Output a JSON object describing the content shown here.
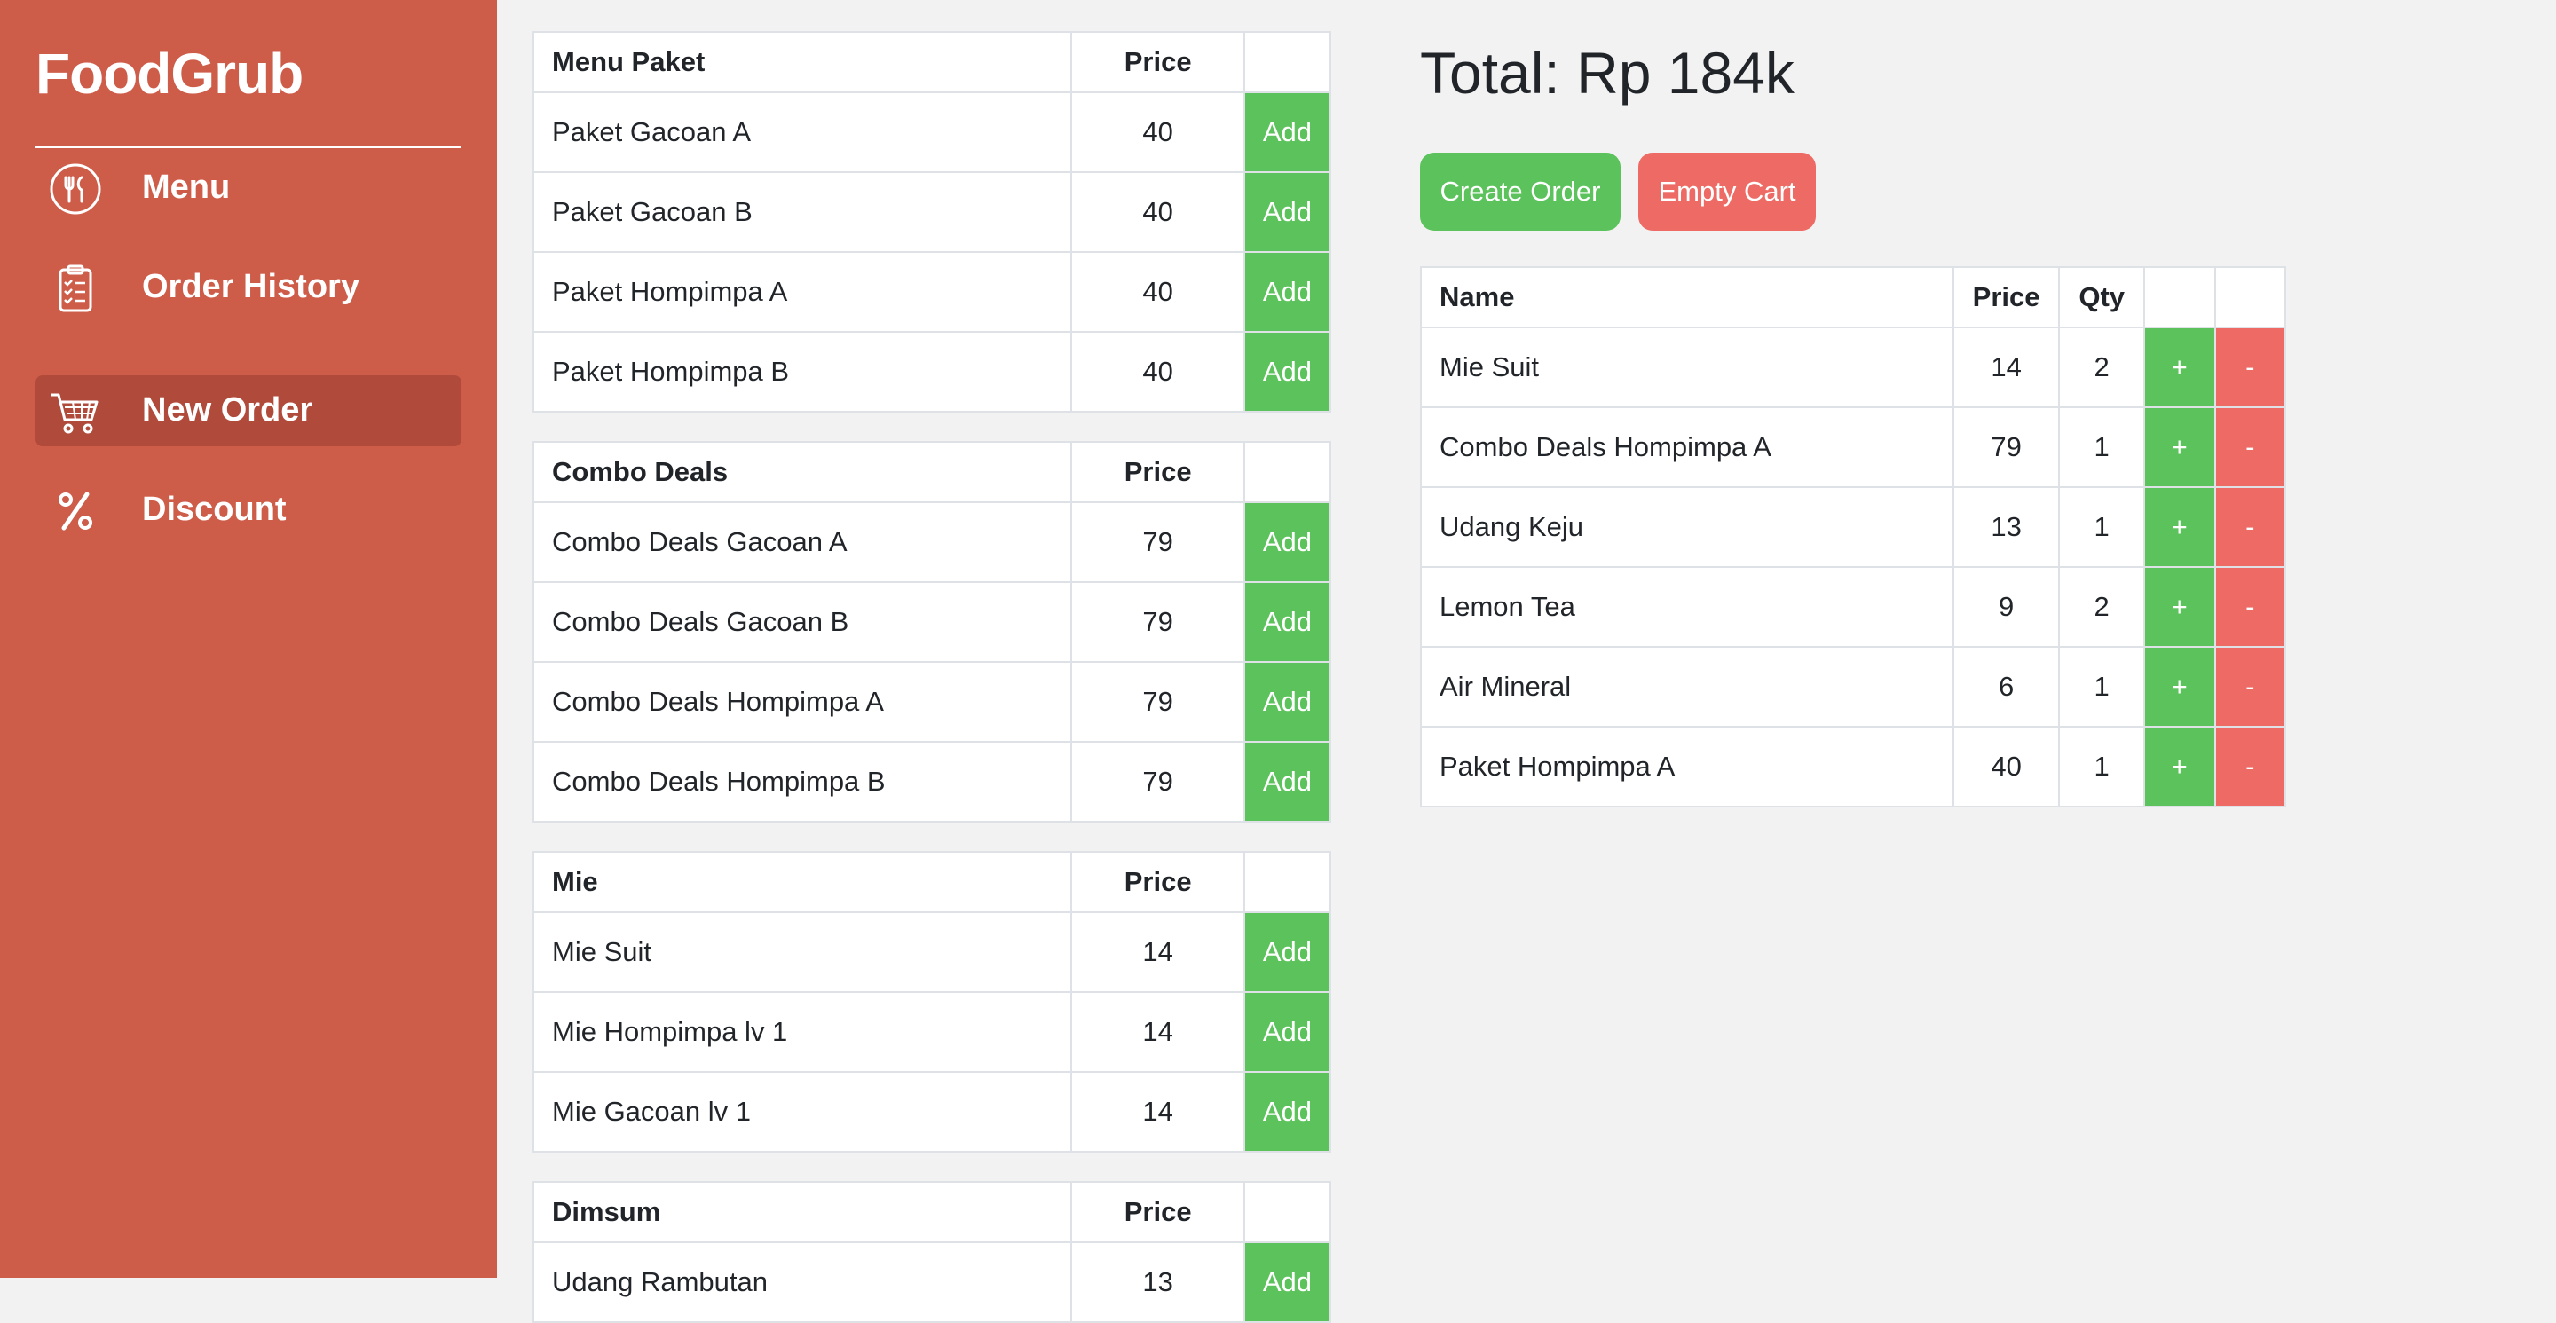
{
  "brand": "FoodGrub",
  "nav": [
    {
      "label": "Menu",
      "icon": "fork-knife-icon",
      "active": false
    },
    {
      "label": "Order History",
      "icon": "clipboard-checklist-icon",
      "active": false
    },
    {
      "label": "New Order",
      "icon": "shopping-cart-icon",
      "active": true
    },
    {
      "label": "Discount",
      "icon": "percent-icon",
      "active": false
    }
  ],
  "menu_tables": [
    {
      "title": "Menu Paket",
      "price_header": "Price",
      "items": [
        {
          "name": "Paket Gacoan A",
          "price": "40",
          "action": "Add"
        },
        {
          "name": "Paket Gacoan B",
          "price": "40",
          "action": "Add"
        },
        {
          "name": "Paket Hompimpa A",
          "price": "40",
          "action": "Add"
        },
        {
          "name": "Paket Hompimpa B",
          "price": "40",
          "action": "Add"
        }
      ]
    },
    {
      "title": "Combo Deals",
      "price_header": "Price",
      "items": [
        {
          "name": "Combo Deals Gacoan A",
          "price": "79",
          "action": "Add"
        },
        {
          "name": "Combo Deals Gacoan B",
          "price": "79",
          "action": "Add"
        },
        {
          "name": "Combo Deals Hompimpa A",
          "price": "79",
          "action": "Add"
        },
        {
          "name": "Combo Deals Hompimpa B",
          "price": "79",
          "action": "Add"
        }
      ]
    },
    {
      "title": "Mie",
      "price_header": "Price",
      "items": [
        {
          "name": "Mie Suit",
          "price": "14",
          "action": "Add"
        },
        {
          "name": "Mie Hompimpa lv 1",
          "price": "14",
          "action": "Add"
        },
        {
          "name": "Mie Gacoan lv 1",
          "price": "14",
          "action": "Add"
        }
      ]
    },
    {
      "title": "Dimsum",
      "price_header": "Price",
      "items": [
        {
          "name": "Udang Rambutan",
          "price": "13",
          "action": "Add"
        }
      ]
    }
  ],
  "total_label": "Total: Rp 184k",
  "create_order_label": "Create Order",
  "empty_cart_label": "Empty Cart",
  "cart": {
    "headers": {
      "name": "Name",
      "price": "Price",
      "qty": "Qty"
    },
    "plus_label": "+",
    "minus_label": "-",
    "items": [
      {
        "name": "Mie Suit",
        "price": "14",
        "qty": "2"
      },
      {
        "name": "Combo Deals Hompimpa A",
        "price": "79",
        "qty": "1"
      },
      {
        "name": "Udang Keju",
        "price": "13",
        "qty": "1"
      },
      {
        "name": "Lemon Tea",
        "price": "9",
        "qty": "2"
      },
      {
        "name": "Air Mineral",
        "price": "6",
        "qty": "1"
      },
      {
        "name": "Paket Hompimpa A",
        "price": "40",
        "qty": "1"
      }
    ]
  },
  "colors": {
    "sidebar": "#cd5c49",
    "sidebar_active": "#b04b3c",
    "success": "#5cc35c",
    "danger": "#ed6b64",
    "background": "#f2f2f2"
  }
}
